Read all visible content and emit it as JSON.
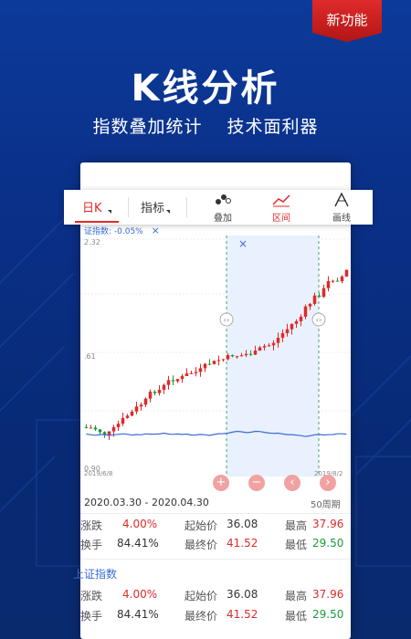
{
  "badge": {
    "label": "新功能"
  },
  "headline": "K线分析",
  "subhead": {
    "left": "指数叠加统计",
    "right": "技术面利器"
  },
  "toolbar": {
    "tabs": [
      {
        "label": "日K",
        "active": true
      },
      {
        "label": "指标"
      }
    ],
    "tools": [
      {
        "label": "叠加",
        "icon": "overlay-icon"
      },
      {
        "label": "区间",
        "icon": "range-icon",
        "active": true
      },
      {
        "label": "画线",
        "icon": "draw-line-icon"
      }
    ]
  },
  "chart": {
    "legend": "证指数: -0.05%",
    "legend_close": "×",
    "y_ticks": [
      "2.32",
      ".61",
      "0.90"
    ],
    "x_ticks": [
      "2019/6/8",
      "2019/8/2"
    ],
    "selection_close": "×",
    "accent_red": "#e02a2a",
    "accent_green": "#1a9a3e",
    "accent_blue": "#3b6bd8"
  },
  "nav_buttons": [
    "+",
    "−",
    "‹",
    "›"
  ],
  "stats": {
    "date_range": "2020.03.30 - 2020.04.30",
    "period": "50周期",
    "rows1": [
      {
        "k1": "涨跌",
        "v1": "4.00%",
        "k2": "起始价",
        "v2": "36.08",
        "k3": "最高",
        "v3": "37.96"
      },
      {
        "k1": "换手",
        "v1": "84.41%",
        "k2": "最终价",
        "v2": "41.52",
        "k3": "最低",
        "v3": "29.50"
      }
    ],
    "index_name": "上证指数",
    "rows2": [
      {
        "k1": "涨跌",
        "v1": "4.00%",
        "k2": "起始价",
        "v2": "36.08",
        "k3": "最高",
        "v3": "37.96"
      },
      {
        "k1": "换手",
        "v1": "84.41%",
        "k2": "最终价",
        "v2": "41.52",
        "k3": "最低",
        "v3": "29.50"
      }
    ]
  }
}
